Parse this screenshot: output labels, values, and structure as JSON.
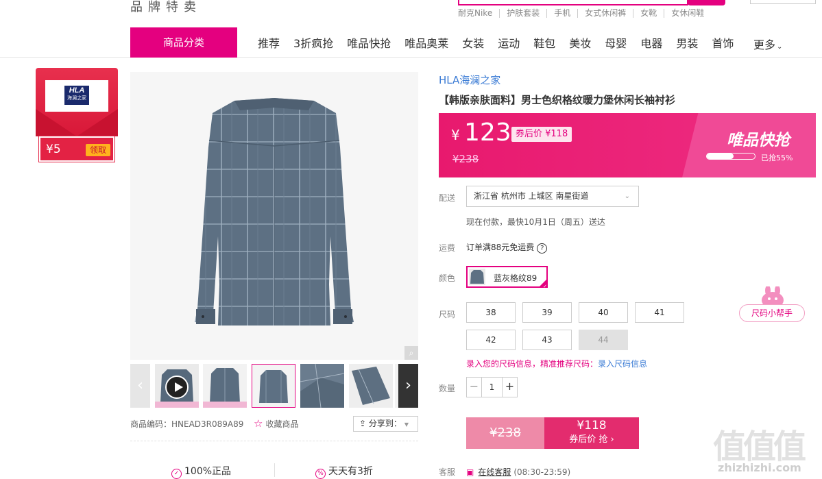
{
  "header": {
    "site_title": "品牌特卖",
    "hot_words": [
      "耐克Nike",
      "护肤套装",
      "手机",
      "女式休闲裤",
      "女靴",
      "女休闲鞋"
    ]
  },
  "nav": {
    "category_label": "商品分类",
    "items": [
      "推荐",
      "3折疯抢",
      "唯品快抢",
      "唯品奥莱",
      "女装",
      "运动",
      "鞋包",
      "美妆",
      "母婴",
      "电器",
      "男装",
      "首饰"
    ],
    "more_label": "更多"
  },
  "coupon": {
    "logo_text": "HLA",
    "logo_sub": "海澜之家",
    "amount": "¥5",
    "get_label": "领取"
  },
  "gallery": {
    "thumb_count": 6,
    "active_index": 2
  },
  "product": {
    "brand": "HLA海澜之家",
    "title": "【韩版亲肤面料】男士色织格纹暖力堡休闲长袖衬衫",
    "code_label": "商品编码：HNEAD3R089A89",
    "favorite_label": "收藏商品",
    "share_label": "分享到："
  },
  "price": {
    "currency": "¥",
    "current": "123",
    "after_coupon": "券后价 ¥118",
    "original": "¥238",
    "flash_title": "唯品快抢",
    "sold_percent": 55,
    "sold_label": "已抢55%"
  },
  "delivery": {
    "label": "配送",
    "address": "浙江省 杭州市 上城区 南星街道",
    "note": "现在付款，最快10月1日（周五）送达"
  },
  "freight": {
    "label": "运费",
    "text": "订单满88元免运费"
  },
  "color": {
    "label": "颜色",
    "selected": "蓝灰格纹89"
  },
  "size": {
    "label": "尺码",
    "options": [
      "38",
      "39",
      "40",
      "41",
      "42",
      "43",
      "44"
    ],
    "disabled": [
      "44"
    ],
    "tip": "录入您的尺码信息，精准推荐尺码：",
    "tip_link": "录入尺码信息"
  },
  "quantity": {
    "label": "数量",
    "value": "1"
  },
  "buy": {
    "original": "¥238",
    "price": "¥118",
    "action": "券后价 抢 ›"
  },
  "service": {
    "label": "客服",
    "link": "在线客服",
    "hours": "(08:30-23:59)"
  },
  "guarantees": [
    "100%正品",
    "天天有3折"
  ],
  "size_helper": "尺码小帮手",
  "watermark": {
    "main": "值值值",
    "sub": "zhizhizhi.com"
  },
  "colors": {
    "accent": "#e4007f",
    "link": "#3a7bd5"
  }
}
